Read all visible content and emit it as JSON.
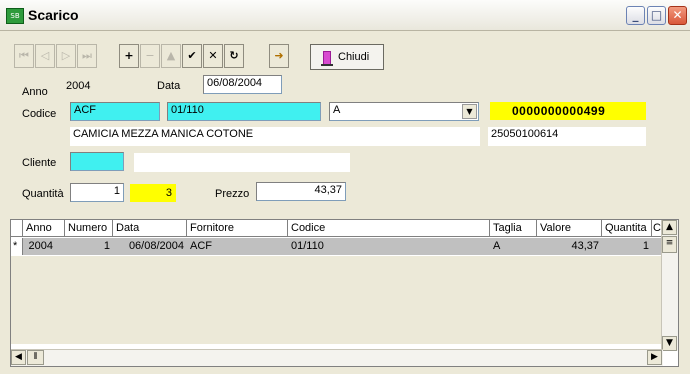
{
  "window": {
    "title": "Scarico",
    "app_icon_label": "SB",
    "min_glyph": "_",
    "max_glyph": "□",
    "close_glyph": "✕"
  },
  "toolbar": {
    "buttons": [
      {
        "glyph": "⏮",
        "enabled": false
      },
      {
        "glyph": "◁",
        "enabled": false
      },
      {
        "glyph": "▷",
        "enabled": false
      },
      {
        "glyph": "⏭",
        "enabled": false
      },
      {
        "glyph": "+",
        "enabled": true
      },
      {
        "glyph": "−",
        "enabled": false
      },
      {
        "glyph": "▲",
        "enabled": false
      },
      {
        "glyph": "✔",
        "enabled": true
      },
      {
        "glyph": "✕",
        "enabled": true
      },
      {
        "glyph": "↻",
        "enabled": true
      }
    ],
    "search_glyph": "➜",
    "close_label": "Chiudi"
  },
  "form": {
    "anno_label": "Anno",
    "anno_value": "2004",
    "data_label": "Data",
    "data_value": "06/08/2004",
    "codice_label": "Codice",
    "codice_fornitore": "ACF",
    "codice_articolo": "01/110",
    "taglia": "A",
    "barcode": "0000000000499",
    "descrizione": "CAMICIA MEZZA MANICA COTONE",
    "codice_ean": "25050100614",
    "cliente_label": "Cliente",
    "cliente_code": "",
    "cliente_name": "",
    "quantita_label": "Quantità",
    "quantita_value": "1",
    "quantita_yellow": "3",
    "prezzo_label": "Prezzo",
    "prezzo_value": "43,37"
  },
  "grid": {
    "columns": [
      "Anno",
      "Numero",
      "Data",
      "Fornitore",
      "Codice",
      "Taglia",
      "Valore",
      "Quantita",
      "Clie"
    ],
    "rows": [
      {
        "marker": "*",
        "anno": "2004",
        "numero": "1",
        "data": "06/08/2004",
        "fornitore": "ACF",
        "codice": "01/110",
        "taglia": "A",
        "valore": "43,37",
        "quantita": "1",
        "cliente": ""
      }
    ]
  },
  "colors": {
    "accent_cyan": "#40f0f0",
    "highlight_yellow": "#ffff00",
    "window_bg": "#ece9d8"
  }
}
